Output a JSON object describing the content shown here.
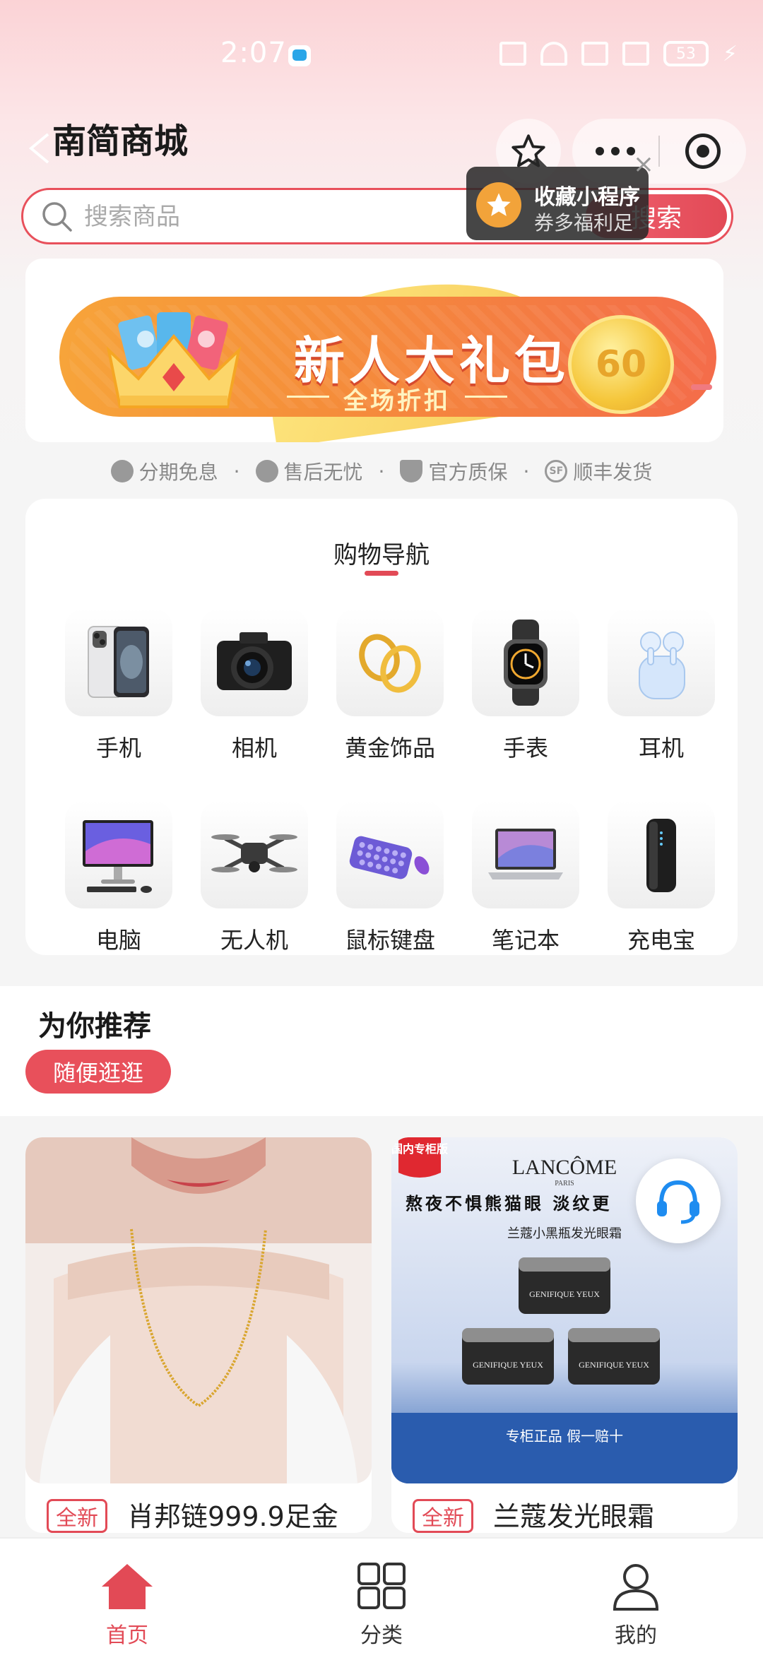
{
  "status_bar": {
    "time": "2:07",
    "battery": "53"
  },
  "header": {
    "title": "南简商城"
  },
  "search": {
    "placeholder": "搜索商品",
    "button_label": "搜索"
  },
  "favorite_tip": {
    "title": "收藏小程序",
    "subtitle": "券多福利足"
  },
  "banner": {
    "title": "新人大礼包",
    "subtitle": "全场折扣",
    "coin_value": "60"
  },
  "guarantees": [
    {
      "label": "分期免息",
      "icon": "installment-icon"
    },
    {
      "label": "售后无忧",
      "icon": "service-icon"
    },
    {
      "label": "官方质保",
      "icon": "shield-icon"
    },
    {
      "label": "顺丰发货",
      "icon": "sf-express-icon"
    }
  ],
  "nav": {
    "title": "购物导航",
    "items": [
      {
        "label": "手机",
        "icon": "phone-icon"
      },
      {
        "label": "相机",
        "icon": "camera-icon"
      },
      {
        "label": "黄金饰品",
        "icon": "gold-ring-icon"
      },
      {
        "label": "手表",
        "icon": "watch-icon"
      },
      {
        "label": "耳机",
        "icon": "earbuds-icon"
      },
      {
        "label": "电脑",
        "icon": "desktop-icon"
      },
      {
        "label": "无人机",
        "icon": "drone-icon"
      },
      {
        "label": "鼠标键盘",
        "icon": "keyboard-icon"
      },
      {
        "label": "笔记本",
        "icon": "laptop-icon"
      },
      {
        "label": "充电宝",
        "icon": "powerbank-icon"
      }
    ]
  },
  "recommend": {
    "title": "为你推荐",
    "tag": "随便逛逛",
    "products": [
      {
        "badge": "全新",
        "name": "肖邦链999.9足金"
      },
      {
        "badge": "全新",
        "name": "兰蔻发光眼霜",
        "image_text": {
          "corner": "国内专柜版",
          "brand": "LANCÔME",
          "city": "PARIS",
          "headline": "熬夜不惧熊猫眼 淡纹更",
          "product_line": "兰蔻小黑瓶发光眼霜",
          "jar_label": "GENIFIQUE YEUX",
          "footer": "专柜正品 假一赔十"
        }
      }
    ]
  },
  "tabbar": {
    "items": [
      {
        "label": "首页",
        "icon": "home-icon",
        "active": true
      },
      {
        "label": "分类",
        "icon": "grid-icon",
        "active": false
      },
      {
        "label": "我的",
        "icon": "user-icon",
        "active": false
      }
    ]
  },
  "colors": {
    "accent": "#e24a56",
    "banner_orange": "#f58e3a",
    "gold": "#f5c63a"
  }
}
